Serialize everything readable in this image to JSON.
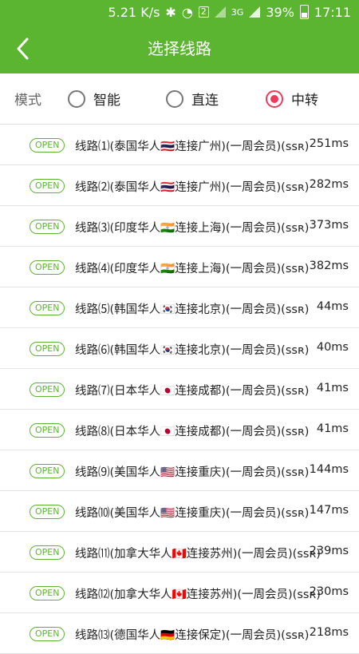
{
  "status": {
    "speed": "5.21 K/s",
    "battery": "39%",
    "time": "17:11",
    "net": "3G"
  },
  "header": {
    "title": "选择线路"
  },
  "mode": {
    "label": "模式",
    "options": [
      {
        "label": "智能",
        "selected": false
      },
      {
        "label": "直连",
        "selected": false
      },
      {
        "label": "中转",
        "selected": true
      }
    ]
  },
  "routes": [
    {
      "badge": "OPEN",
      "name": "线路⑴(泰国华人🇹🇭连接广州)(一周会员)(ssʀ)",
      "ping": "251ms"
    },
    {
      "badge": "OPEN",
      "name": "线路⑵(泰国华人🇹🇭连接广州)(一周会员)(ssʀ)",
      "ping": "282ms"
    },
    {
      "badge": "OPEN",
      "name": "线路⑶(印度华人🇮🇳连接上海)(一周会员)(ssʀ)",
      "ping": "373ms"
    },
    {
      "badge": "OPEN",
      "name": "线路⑷(印度华人🇮🇳连接上海)(一周会员)(ssʀ)",
      "ping": "382ms"
    },
    {
      "badge": "OPEN",
      "name": "线路⑸(韩国华人🇰🇷连接北京)(一周会员)(ssʀ)",
      "ping": "44ms"
    },
    {
      "badge": "OPEN",
      "name": "线路⑹(韩国华人🇰🇷连接北京)(一周会员)(ssʀ)",
      "ping": "40ms"
    },
    {
      "badge": "OPEN",
      "name": "线路⑺(日本华人🇯🇵连接成都)(一周会员)(ssʀ)",
      "ping": "41ms"
    },
    {
      "badge": "OPEN",
      "name": "线路⑻(日本华人🇯🇵连接成都)(一周会员)(ssʀ)",
      "ping": "41ms"
    },
    {
      "badge": "OPEN",
      "name": "线路⑼(美国华人🇺🇸连接重庆)(一周会员)(ssʀ)",
      "ping": "144ms"
    },
    {
      "badge": "OPEN",
      "name": "线路⑽(美国华人🇺🇸连接重庆)(一周会员)(ssʀ)",
      "ping": "147ms"
    },
    {
      "badge": "OPEN",
      "name": "线路⑾(加拿大华人🇨🇦连接苏州)(一周会员)(ssʀ)",
      "ping": "239ms"
    },
    {
      "badge": "OPEN",
      "name": "线路⑿(加拿大华人🇨🇦连接苏州)(一周会员)(ssʀ)",
      "ping": "230ms"
    },
    {
      "badge": "OPEN",
      "name": "线路⒀(德国华人🇩🇪连接保定)(一周会员)(ssʀ)",
      "ping": "218ms"
    }
  ],
  "colors": {
    "accent": "#5cb531",
    "selected_radio": "#ee3a5c"
  }
}
